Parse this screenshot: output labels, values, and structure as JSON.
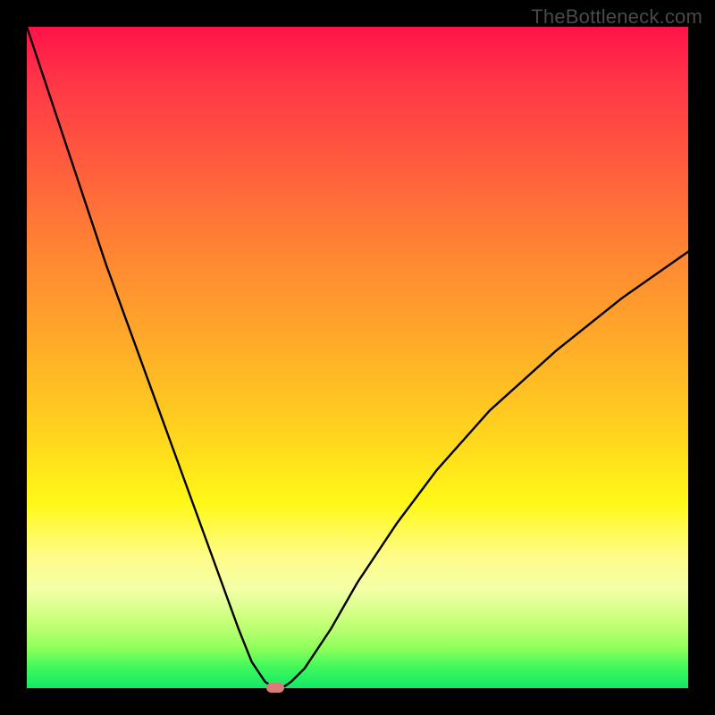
{
  "watermark": "TheBottleneck.com",
  "chart_data": {
    "type": "line",
    "title": "",
    "xlabel": "",
    "ylabel": "",
    "xlim": [
      0,
      100
    ],
    "ylim": [
      0,
      100
    ],
    "grid": false,
    "series": [
      {
        "name": "curve",
        "x": [
          0,
          4,
          8,
          12,
          16,
          20,
          24,
          28,
          32,
          34,
          36,
          37,
          37.5,
          38,
          39,
          40,
          42,
          46,
          50,
          56,
          62,
          70,
          80,
          90,
          100
        ],
        "y": [
          100,
          88,
          76,
          64,
          53,
          42,
          31,
          20,
          9,
          4,
          1,
          0.3,
          0.2,
          0.2,
          0.3,
          1,
          3,
          9,
          16,
          25,
          33,
          42,
          51,
          59,
          66
        ]
      }
    ],
    "marker": {
      "x": 37.5,
      "y": 0.2
    },
    "colors": {
      "gradient_top": "#ff1249",
      "gradient_bottom": "#13e968",
      "curve": "#000000",
      "marker": "#d97c77"
    }
  }
}
